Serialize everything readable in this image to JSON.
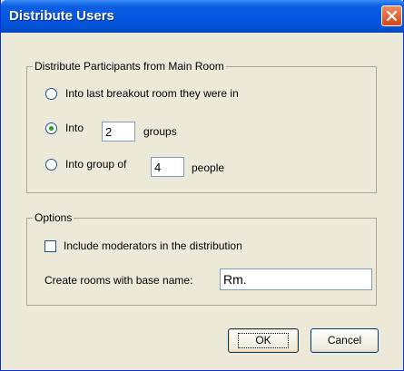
{
  "window": {
    "title": "Distribute Users"
  },
  "distribute": {
    "legend": "Distribute Participants from Main Room",
    "option_last_room": "Into last breakout room they were in",
    "option_groups_prefix": "Into",
    "groups_value": "2",
    "option_groups_suffix": "groups",
    "option_size_prefix": "Into group of",
    "size_value": "4",
    "option_size_suffix": "people",
    "selected": "groups"
  },
  "options": {
    "legend": "Options",
    "include_moderators_label": "Include moderators in the distribution",
    "include_moderators_checked": false,
    "base_name_label": "Create rooms with base name:",
    "base_name_value": "Rm."
  },
  "buttons": {
    "ok": "OK",
    "cancel": "Cancel"
  }
}
